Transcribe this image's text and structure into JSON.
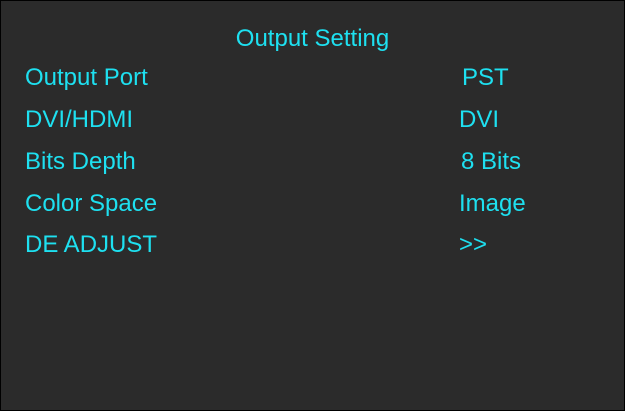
{
  "title": "Output Setting",
  "colors": {
    "background": "#2b2b2b",
    "text": "#1ee0f0",
    "border": "#000000"
  },
  "items": [
    {
      "label": "Output Port",
      "value": "PST"
    },
    {
      "label": "DVI/HDMI",
      "value": "DVI"
    },
    {
      "label": "Bits Depth",
      "value": "8 Bits"
    },
    {
      "label": "Color Space",
      "value": "Image"
    },
    {
      "label": "DE ADJUST",
      "value": ">>"
    }
  ]
}
